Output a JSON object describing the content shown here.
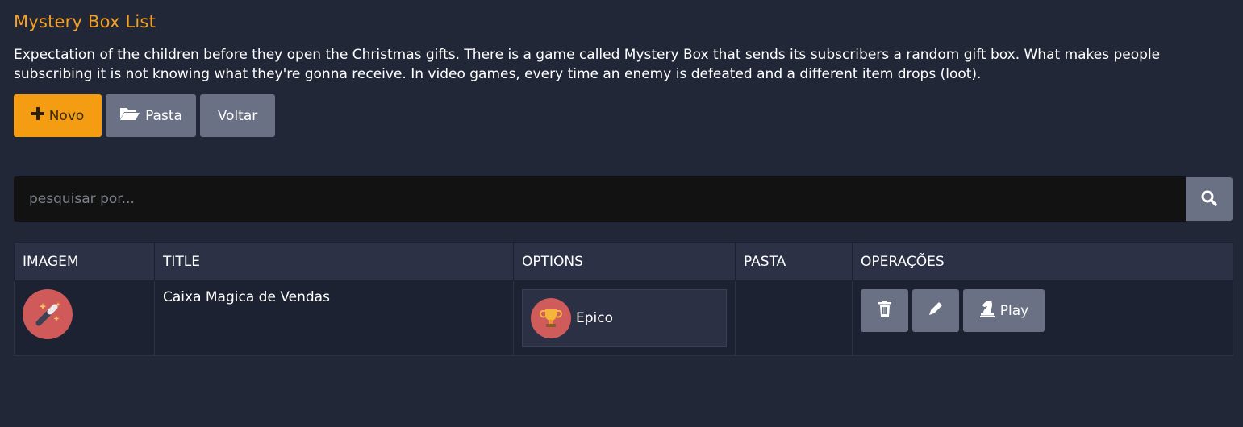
{
  "header": {
    "title": "Mystery Box List",
    "description": "Expectation of the children before they open the Christmas gifts. There is a game called Mystery Box that sends its subscribers a random gift box. What makes people subscribing it is not knowing what they're gonna receive. In video games, every time an enemy is defeated and a different item drops (loot)."
  },
  "toolbar": {
    "new_label": "Novo",
    "folder_label": "Pasta",
    "back_label": "Voltar"
  },
  "search": {
    "placeholder": "pesquisar por..."
  },
  "table": {
    "columns": [
      "IMAGEM",
      "TITLE",
      "OPTIONS",
      "PASTA",
      "OPERAÇÕES"
    ],
    "rows": [
      {
        "image_icon": "magic-wand-icon",
        "title": "Caixa Magica de Vendas",
        "option_icon": "trophy-icon",
        "option_label": "Epico",
        "pasta": "",
        "operations": {
          "delete_icon": "trash-icon",
          "edit_icon": "pencil-icon",
          "play_icon": "chess-knight-icon",
          "play_label": "Play"
        }
      }
    ]
  },
  "colors": {
    "background": "#222738",
    "accent": "#f49c12",
    "title": "#f4a020",
    "secondary_button": "#6b7184"
  }
}
